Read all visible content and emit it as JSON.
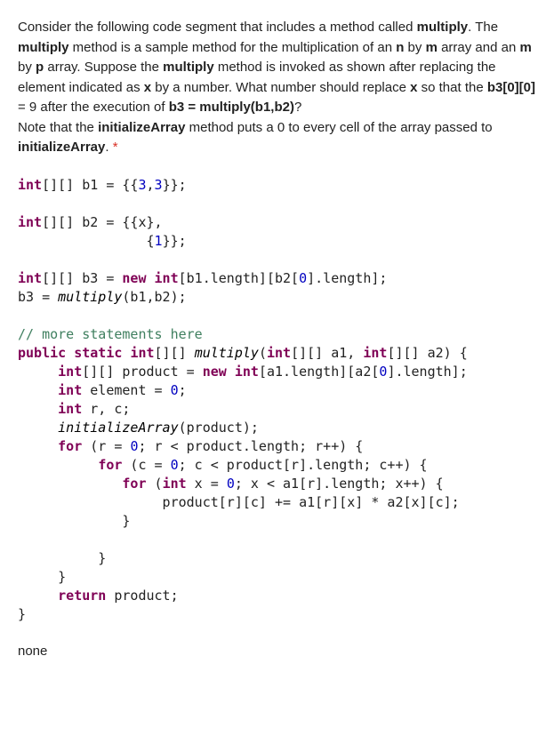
{
  "prompt": {
    "p1_a": "Consider the following code segment that includes a method called ",
    "p1_b": "multiply",
    "p1_c": ". The ",
    "p1_d": "multiply",
    "p1_e": " method is a sample method for the multiplication of an ",
    "p1_f": "n",
    "p1_g": " by ",
    "p1_h": "m",
    "p1_i": " array and an ",
    "p1_j": "m",
    "p1_k": " by ",
    "p1_l": "p",
    "p1_m": " array. Suppose the ",
    "p1_n": "multiply",
    "p1_o": " method is invoked as shown after replacing the element indicated as ",
    "p1_p": "x",
    "p1_q": " by a number. What number should replace ",
    "p1_r": "x",
    "p1_s": " so that the ",
    "p1_t": "b3[0][0]",
    "p1_u": " = 9 after the execution of ",
    "p1_v": "b3 = multiply(b1,b2)",
    "p1_w": "?",
    "p2_a": "Note that the ",
    "p2_b": "initializeArray",
    "p2_c": " method puts a 0 to every cell of the array passed to ",
    "p2_d": "initializeArray",
    "p2_e": ".",
    "star": " *"
  },
  "code": {
    "int": "int",
    "new": "new",
    "public": "public",
    "static": "static",
    "for": "for",
    "return": "return",
    "b1_decl": "[][] b1 = {{",
    "n3a": "3",
    "comma": ",",
    "n3b": "3",
    "b1_end": "}};",
    "b2_line1": "[][] b2 = {{x},",
    "b2_line2_pad": "                {",
    "n1": "1",
    "b2_line2_end": "}};",
    "b3_line1_a": "[][] b3 = ",
    "b3_line1_b": " ",
    "b3_line1_c": "[b1.length][b2[",
    "n0a": "0",
    "b3_line1_d": "].length];",
    "b3_line2_a": "b3 = ",
    "b3_line2_b": "multiply",
    "b3_line2_c": "(b1,b2);",
    "comment1": "// more statements here",
    "m1_a": " ",
    "m1_b": " ",
    "m1_c": "[][] ",
    "m1_d": "multiply",
    "m1_e": "(",
    "m1_f": "[][] a1, ",
    "m1_g": "[][] a2) {",
    "m2_a": "     ",
    "m2_b": "[][] product = ",
    "m2_c": " ",
    "m2_d": "[a1.length][a2[",
    "n0b": "0",
    "m2_e": "].length];",
    "m3_a": "     ",
    "m3_b": " element = ",
    "n0c": "0",
    "m3_c": ";",
    "m4_a": "     ",
    "m4_b": " r, c;",
    "m5_a": "     ",
    "m5_b": "initializeArray",
    "m5_c": "(product);",
    "m6_a": "     ",
    "m6_b": " (r = ",
    "n0d": "0",
    "m6_c": "; r < product.length; r++) {",
    "m7_a": "          ",
    "m7_b": " (c = ",
    "n0e": "0",
    "m7_c": "; c < product[r].length; c++) {",
    "m8_a": "             ",
    "m8_b": " (",
    "m8_c": " x = ",
    "n0f": "0",
    "m8_d": "; x < a1[r].length; x++) {",
    "m9": "                  product[r][c] += a1[r][x] * a2[x][c];",
    "m10": "             }",
    "m11": "",
    "m12": "          }",
    "m13": "     }",
    "m14_a": "     ",
    "m14_b": " product;",
    "m15": "}"
  },
  "answer": "none"
}
